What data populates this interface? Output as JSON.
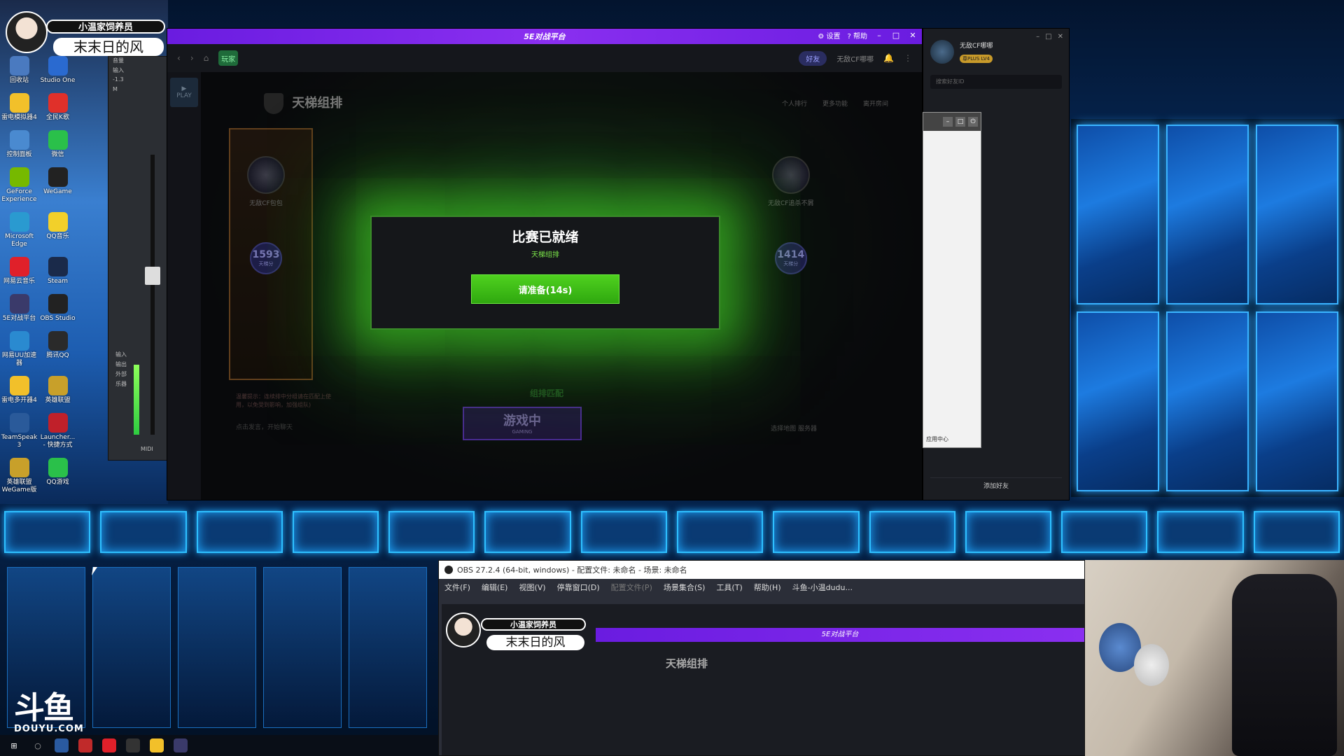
{
  "overlay": {
    "title": "小温家饲养员",
    "name": "末末日的风"
  },
  "desktop": {
    "icons": [
      {
        "label": "回收站",
        "icon": "recycle-bin-icon",
        "color": "#4a7ac0"
      },
      {
        "label": "Studio One",
        "icon": "studio-one-icon",
        "color": "#2a6ad0"
      },
      {
        "label": "雷电模拟器4",
        "icon": "ldplayer-icon",
        "color": "#f2c02a"
      },
      {
        "label": "全民K歌",
        "icon": "kge-icon",
        "color": "#e0302a"
      },
      {
        "label": "控制面板",
        "icon": "control-panel-icon",
        "color": "#4a8ad0"
      },
      {
        "label": "微信",
        "icon": "wechat-icon",
        "color": "#2ac04a"
      },
      {
        "label": "GeForce Experience",
        "icon": "geforce-icon",
        "color": "#76b900"
      },
      {
        "label": "WeGame",
        "icon": "wegame-icon",
        "color": "#222222"
      },
      {
        "label": "Microsoft Edge",
        "icon": "edge-icon",
        "color": "#2a9ad0"
      },
      {
        "label": "QQ音乐",
        "icon": "qqmusic-icon",
        "color": "#f2d02a"
      },
      {
        "label": "网易云音乐",
        "icon": "netease-music-icon",
        "color": "#e0202a"
      },
      {
        "label": "Steam",
        "icon": "steam-icon",
        "color": "#1a2a4a"
      },
      {
        "label": "5E对战平台",
        "icon": "5e-icon",
        "color": "#3a3a6a"
      },
      {
        "label": "OBS Studio",
        "icon": "obs-icon",
        "color": "#222222"
      },
      {
        "label": "网易UU加速器",
        "icon": "uu-icon",
        "color": "#2a8ad0"
      },
      {
        "label": "腾讯QQ",
        "icon": "qq-icon",
        "color": "#2a2a2a"
      },
      {
        "label": "雷电多开器4",
        "icon": "ldmulti-icon",
        "color": "#f2c02a"
      },
      {
        "label": "英雄联盟",
        "icon": "lol-icon",
        "color": "#c8a02a"
      },
      {
        "label": "TeamSpeak 3",
        "icon": "teamspeak-icon",
        "color": "#2a5a9a"
      },
      {
        "label": "Launcher... - 快捷方式",
        "icon": "launcher-icon",
        "color": "#c0202a"
      },
      {
        "label": "英雄联盟WeGame版",
        "icon": "lol-wegame-icon",
        "color": "#c8a02a"
      },
      {
        "label": "QQ游戏",
        "icon": "qqgame-icon",
        "color": "#2ac04a"
      }
    ]
  },
  "mixer": {
    "label_top": "音量",
    "rows": [
      "输入",
      "-1.3",
      "M",
      "输入",
      "输出",
      "外部",
      "乐器",
      "MIDI"
    ]
  },
  "game_client": {
    "titlebar": {
      "logo": "5E对战平台",
      "settings": "设置",
      "help": "帮助",
      "minimize": "–",
      "maximize": "□",
      "close": "✕"
    },
    "nav": {
      "badge": "玩家",
      "friends": "好友",
      "username": "无敌CF哪哪"
    },
    "side": {
      "play": "PLAY"
    },
    "mode_title": "天梯组排",
    "top_links": [
      "个人排行",
      "更多功能",
      "离开房间"
    ],
    "players": [
      {
        "name": "无敌CF包包",
        "rank": "1593",
        "rank_label": "天梯分"
      },
      {
        "name": "无敌CF追杀不屑",
        "rank": "1414",
        "rank_label": "天梯分"
      }
    ],
    "match_label": "组排匹配",
    "gaming": {
      "label": "游戏中",
      "sub": "GAMING"
    },
    "chat_hint": "点击发言，开始聊天",
    "server_row": "选择地图 服务器 ",
    "notice": "温馨提示：连续排中分组请在匹配上使用，以免受到影响，加强组队)"
  },
  "ready_modal": {
    "title": "比赛已就绪",
    "subtitle": "天梯组排",
    "accept_button": "请准备(14s)"
  },
  "friends_panel": {
    "username": "无敌CF哪哪",
    "level": "尊PLUS LV4",
    "search_placeholder": "搜索好友ID",
    "add_friend": "添加好友",
    "app_center": "应用中心"
  },
  "obs": {
    "title": "OBS 27.2.4 (64-bit, windows) - 配置文件: 未命名 - 场景: 未命名",
    "menu": [
      "文件(F)",
      "编辑(E)",
      "视图(V)",
      "停靠窗口(D)",
      "配置文件(P)",
      "场景集合(S)",
      "工具(T)",
      "帮助(H)",
      "斗鱼-小温dudu..."
    ],
    "preview_logo": "5E对战平台",
    "preview_mode": "天梯组排"
  },
  "watermark": {
    "big": "斗鱼",
    "small": "DOUYU.COM"
  },
  "colors": {
    "brand_purple": "#7a26e8",
    "accept_green": "#3fbf17",
    "accent_green": "#7de84a"
  }
}
